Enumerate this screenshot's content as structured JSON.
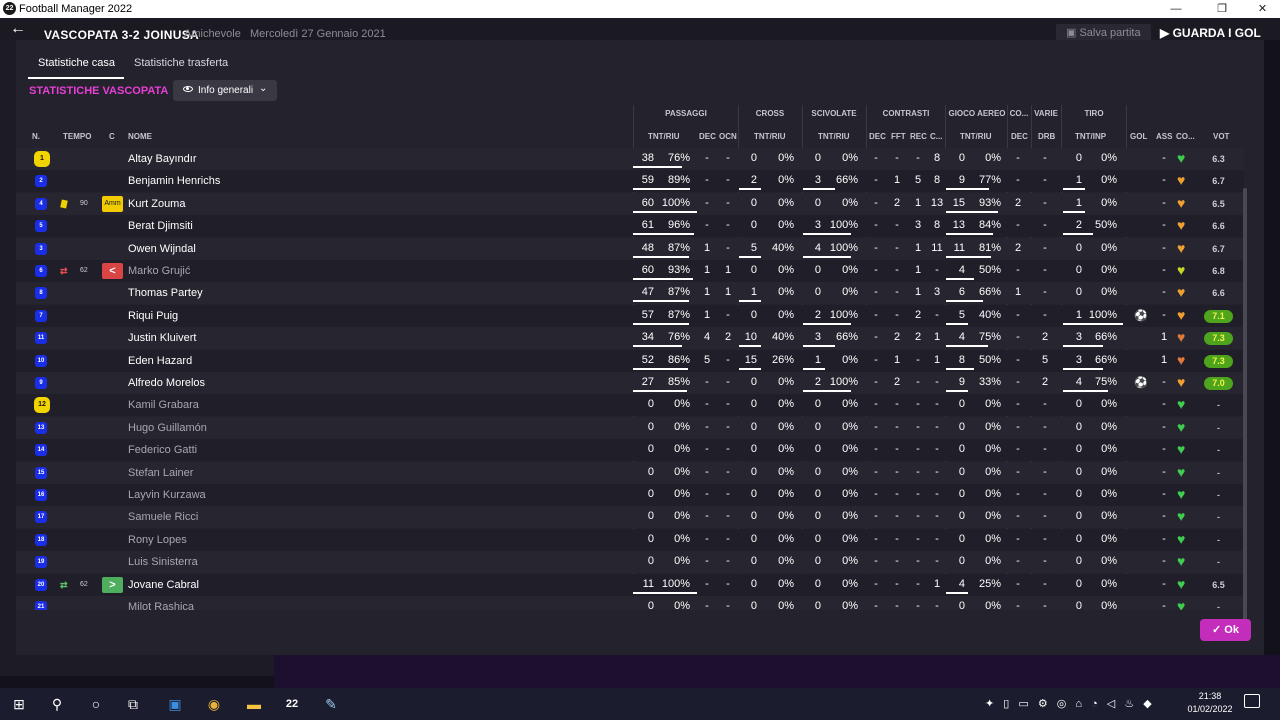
{
  "window": {
    "title": "Football Manager 2022",
    "min": "—",
    "max": "❐",
    "close": "✕"
  },
  "header": {
    "score": "VASCOPATA 3-2 JOINUSA",
    "match_type": "Amichevole",
    "date": "Mercoledì 27 Gennaio 2021",
    "save_label": "Salva partita",
    "continue_label": "GUARDA I GOL"
  },
  "tabs": {
    "home": "Statistiche casa",
    "away": "Statistiche trasferta"
  },
  "section": {
    "title": "STATISTICHE VASCOPATA",
    "view": "Info generali"
  },
  "groups": {
    "passaggi": "PASSAGGI",
    "cross": "CROSS",
    "scivolate": "SCIVOLATE",
    "contrasti": "CONTRASTI",
    "gioco_aereo": "GIOCO AEREO",
    "co": "CO...",
    "varie": "VARIE",
    "tiro": "TIRO"
  },
  "columns": {
    "n": "N.",
    "tempo": "TEMPO",
    "c": "C",
    "nome": "NOME",
    "pass_tnt": "TNT/RIU",
    "pass_dec": "DEC",
    "pass_ocn": "OCN",
    "cross_tnt": "TNT/RIU",
    "sciv_tnt": "TNT/RIU",
    "con_dec": "DEC",
    "con_fft": "FFT",
    "con_rec": "REC",
    "con_c": "C...",
    "aereo_tnt": "TNT/RIU",
    "co_dec": "DEC",
    "varie_drb": "DRB",
    "tiro_tnt": "TNT/INP",
    "gol": "GOL",
    "ass": "ASS",
    "co2": "CO...",
    "vot": "VOT"
  },
  "players": [
    {
      "num": "1",
      "gk": true,
      "tempo": "",
      "event": "",
      "cbox": "",
      "name": "Altay Bayındır",
      "dim": false,
      "pt": "38",
      "pp": "76%",
      "pdec": "-",
      "pocn": "-",
      "ct": "0",
      "cp": "0%",
      "st": "0",
      "sp": "0%",
      "cdec": "-",
      "cfft": "-",
      "crec": "-",
      "cc": "8",
      "at": "0",
      "ap": "0%",
      "codec": "-",
      "drb": "-",
      "tt": "0",
      "tp": "0%",
      "gol": "",
      "ass": "-",
      "heart": "#3fcc4f",
      "vote": "6.3",
      "vhi": false
    },
    {
      "num": "2",
      "gk": false,
      "tempo": "",
      "event": "",
      "cbox": "",
      "name": "Benjamin Henrichs",
      "dim": false,
      "pt": "59",
      "pp": "89%",
      "pdec": "-",
      "pocn": "-",
      "ct": "2",
      "cp": "0%",
      "st": "3",
      "sp": "66%",
      "cdec": "-",
      "cfft": "1",
      "crec": "5",
      "cc": "8",
      "at": "9",
      "ap": "77%",
      "codec": "-",
      "drb": "-",
      "tt": "1",
      "tp": "0%",
      "gol": "",
      "ass": "-",
      "heart": "#f0a030",
      "vote": "6.7",
      "vhi": false
    },
    {
      "num": "4",
      "gk": false,
      "tempo": "90",
      "event": "yellow",
      "cbox": "amm",
      "cbox_label": "Amm",
      "name": "Kurt Zouma",
      "dim": false,
      "pt": "60",
      "pp": "100%",
      "pdec": "-",
      "pocn": "-",
      "ct": "0",
      "cp": "0%",
      "st": "0",
      "sp": "0%",
      "cdec": "-",
      "cfft": "2",
      "crec": "1",
      "cc": "13",
      "at": "15",
      "ap": "93%",
      "codec": "2",
      "drb": "-",
      "tt": "1",
      "tp": "0%",
      "gol": "",
      "ass": "-",
      "heart": "#f0a030",
      "vote": "6.5",
      "vhi": false
    },
    {
      "num": "5",
      "gk": false,
      "tempo": "",
      "event": "",
      "cbox": "",
      "name": "Berat Djimsiti",
      "dim": false,
      "pt": "61",
      "pp": "96%",
      "pdec": "-",
      "pocn": "-",
      "ct": "0",
      "cp": "0%",
      "st": "3",
      "sp": "100%",
      "cdec": "-",
      "cfft": "-",
      "crec": "3",
      "cc": "8",
      "at": "13",
      "ap": "84%",
      "codec": "-",
      "drb": "-",
      "tt": "2",
      "tp": "50%",
      "gol": "",
      "ass": "-",
      "heart": "#f0a030",
      "vote": "6.6",
      "vhi": false
    },
    {
      "num": "3",
      "gk": false,
      "tempo": "",
      "event": "",
      "cbox": "",
      "name": "Owen Wijndal",
      "dim": false,
      "pt": "48",
      "pp": "87%",
      "pdec": "1",
      "pocn": "-",
      "ct": "5",
      "cp": "40%",
      "st": "4",
      "sp": "100%",
      "cdec": "-",
      "cfft": "-",
      "crec": "1",
      "cc": "11",
      "at": "11",
      "ap": "81%",
      "codec": "2",
      "drb": "-",
      "tt": "0",
      "tp": "0%",
      "gol": "",
      "ass": "-",
      "heart": "#f0a030",
      "vote": "6.7",
      "vhi": false
    },
    {
      "num": "6",
      "gk": false,
      "tempo": "62",
      "event": "out",
      "cbox": "subout",
      "cbox_label": "<",
      "name": "Marko Grujić",
      "dim": true,
      "pt": "60",
      "pp": "93%",
      "pdec": "1",
      "pocn": "1",
      "ct": "0",
      "cp": "0%",
      "st": "0",
      "sp": "0%",
      "cdec": "-",
      "cfft": "-",
      "crec": "1",
      "cc": "-",
      "at": "4",
      "ap": "50%",
      "codec": "-",
      "drb": "-",
      "tt": "0",
      "tp": "0%",
      "gol": "",
      "ass": "-",
      "heart": "#c8d628",
      "vote": "6.8",
      "vhi": false
    },
    {
      "num": "8",
      "gk": false,
      "tempo": "",
      "event": "",
      "cbox": "",
      "name": "Thomas Partey",
      "dim": false,
      "pt": "47",
      "pp": "87%",
      "pdec": "1",
      "pocn": "1",
      "ct": "1",
      "cp": "0%",
      "st": "0",
      "sp": "0%",
      "cdec": "-",
      "cfft": "-",
      "crec": "1",
      "cc": "3",
      "at": "6",
      "ap": "66%",
      "codec": "1",
      "drb": "-",
      "tt": "0",
      "tp": "0%",
      "gol": "",
      "ass": "-",
      "heart": "#f0a030",
      "vote": "6.6",
      "vhi": false
    },
    {
      "num": "7",
      "gk": false,
      "tempo": "",
      "event": "",
      "cbox": "",
      "name": "Riqui Puig",
      "dim": false,
      "pt": "57",
      "pp": "87%",
      "pdec": "1",
      "pocn": "-",
      "ct": "0",
      "cp": "0%",
      "st": "2",
      "sp": "100%",
      "cdec": "-",
      "cfft": "-",
      "crec": "2",
      "cc": "-",
      "at": "5",
      "ap": "40%",
      "codec": "-",
      "drb": "-",
      "tt": "1",
      "tp": "100%",
      "gol": "⚽",
      "ass": "-",
      "heart": "#f0a030",
      "vote": "7.1",
      "vhi": true
    },
    {
      "num": "11",
      "gk": false,
      "tempo": "",
      "event": "",
      "cbox": "",
      "name": "Justin Kluivert",
      "dim": false,
      "pt": "34",
      "pp": "76%",
      "pdec": "4",
      "pocn": "2",
      "ct": "10",
      "cp": "40%",
      "st": "3",
      "sp": "66%",
      "cdec": "-",
      "cfft": "2",
      "crec": "2",
      "cc": "1",
      "at": "4",
      "ap": "75%",
      "codec": "-",
      "drb": "2",
      "tt": "3",
      "tp": "66%",
      "gol": "",
      "ass": "1",
      "heart": "#e07a3a",
      "vote": "7.3",
      "vhi": true
    },
    {
      "num": "10",
      "gk": false,
      "tempo": "",
      "event": "",
      "cbox": "",
      "name": "Eden Hazard",
      "dim": false,
      "pt": "52",
      "pp": "86%",
      "pdec": "5",
      "pocn": "-",
      "ct": "15",
      "cp": "26%",
      "st": "1",
      "sp": "0%",
      "cdec": "-",
      "cfft": "1",
      "crec": "-",
      "cc": "1",
      "at": "8",
      "ap": "50%",
      "codec": "-",
      "drb": "5",
      "tt": "3",
      "tp": "66%",
      "gol": "",
      "ass": "1",
      "heart": "#e07a3a",
      "vote": "7.3",
      "vhi": true
    },
    {
      "num": "9",
      "gk": false,
      "tempo": "",
      "event": "",
      "cbox": "",
      "name": "Alfredo Morelos",
      "dim": false,
      "pt": "27",
      "pp": "85%",
      "pdec": "-",
      "pocn": "-",
      "ct": "0",
      "cp": "0%",
      "st": "2",
      "sp": "100%",
      "cdec": "-",
      "cfft": "2",
      "crec": "-",
      "cc": "-",
      "at": "9",
      "ap": "33%",
      "codec": "-",
      "drb": "2",
      "tt": "4",
      "tp": "75%",
      "gol": "⚽",
      "ass": "-",
      "heart": "#f0a030",
      "vote": "7.0",
      "vhi": true
    },
    {
      "num": "12",
      "gk": true,
      "tempo": "",
      "event": "",
      "cbox": "",
      "name": "Kamil Grabara",
      "dim": true,
      "pt": "0",
      "pp": "0%",
      "pdec": "-",
      "pocn": "-",
      "ct": "0",
      "cp": "0%",
      "st": "0",
      "sp": "0%",
      "cdec": "-",
      "cfft": "-",
      "crec": "-",
      "cc": "-",
      "at": "0",
      "ap": "0%",
      "codec": "-",
      "drb": "-",
      "tt": "0",
      "tp": "0%",
      "gol": "",
      "ass": "-",
      "heart": "#3fcc4f",
      "vote": "-",
      "vhi": false
    },
    {
      "num": "13",
      "gk": false,
      "tempo": "",
      "event": "",
      "cbox": "",
      "name": "Hugo Guillamón",
      "dim": true,
      "pt": "0",
      "pp": "0%",
      "pdec": "-",
      "pocn": "-",
      "ct": "0",
      "cp": "0%",
      "st": "0",
      "sp": "0%",
      "cdec": "-",
      "cfft": "-",
      "crec": "-",
      "cc": "-",
      "at": "0",
      "ap": "0%",
      "codec": "-",
      "drb": "-",
      "tt": "0",
      "tp": "0%",
      "gol": "",
      "ass": "-",
      "heart": "#3fcc4f",
      "vote": "-",
      "vhi": false
    },
    {
      "num": "14",
      "gk": false,
      "tempo": "",
      "event": "",
      "cbox": "",
      "name": "Federico Gatti",
      "dim": true,
      "pt": "0",
      "pp": "0%",
      "pdec": "-",
      "pocn": "-",
      "ct": "0",
      "cp": "0%",
      "st": "0",
      "sp": "0%",
      "cdec": "-",
      "cfft": "-",
      "crec": "-",
      "cc": "-",
      "at": "0",
      "ap": "0%",
      "codec": "-",
      "drb": "-",
      "tt": "0",
      "tp": "0%",
      "gol": "",
      "ass": "-",
      "heart": "#3fcc4f",
      "vote": "-",
      "vhi": false
    },
    {
      "num": "15",
      "gk": false,
      "tempo": "",
      "event": "",
      "cbox": "",
      "name": "Stefan Lainer",
      "dim": true,
      "pt": "0",
      "pp": "0%",
      "pdec": "-",
      "pocn": "-",
      "ct": "0",
      "cp": "0%",
      "st": "0",
      "sp": "0%",
      "cdec": "-",
      "cfft": "-",
      "crec": "-",
      "cc": "-",
      "at": "0",
      "ap": "0%",
      "codec": "-",
      "drb": "-",
      "tt": "0",
      "tp": "0%",
      "gol": "",
      "ass": "-",
      "heart": "#3fcc4f",
      "vote": "-",
      "vhi": false
    },
    {
      "num": "16",
      "gk": false,
      "tempo": "",
      "event": "",
      "cbox": "",
      "name": "Layvin Kurzawa",
      "dim": true,
      "pt": "0",
      "pp": "0%",
      "pdec": "-",
      "pocn": "-",
      "ct": "0",
      "cp": "0%",
      "st": "0",
      "sp": "0%",
      "cdec": "-",
      "cfft": "-",
      "crec": "-",
      "cc": "-",
      "at": "0",
      "ap": "0%",
      "codec": "-",
      "drb": "-",
      "tt": "0",
      "tp": "0%",
      "gol": "",
      "ass": "-",
      "heart": "#3fcc4f",
      "vote": "-",
      "vhi": false
    },
    {
      "num": "17",
      "gk": false,
      "tempo": "",
      "event": "",
      "cbox": "",
      "name": "Samuele Ricci",
      "dim": true,
      "pt": "0",
      "pp": "0%",
      "pdec": "-",
      "pocn": "-",
      "ct": "0",
      "cp": "0%",
      "st": "0",
      "sp": "0%",
      "cdec": "-",
      "cfft": "-",
      "crec": "-",
      "cc": "-",
      "at": "0",
      "ap": "0%",
      "codec": "-",
      "drb": "-",
      "tt": "0",
      "tp": "0%",
      "gol": "",
      "ass": "-",
      "heart": "#3fcc4f",
      "vote": "-",
      "vhi": false
    },
    {
      "num": "18",
      "gk": false,
      "tempo": "",
      "event": "",
      "cbox": "",
      "name": "Rony Lopes",
      "dim": true,
      "pt": "0",
      "pp": "0%",
      "pdec": "-",
      "pocn": "-",
      "ct": "0",
      "cp": "0%",
      "st": "0",
      "sp": "0%",
      "cdec": "-",
      "cfft": "-",
      "crec": "-",
      "cc": "-",
      "at": "0",
      "ap": "0%",
      "codec": "-",
      "drb": "-",
      "tt": "0",
      "tp": "0%",
      "gol": "",
      "ass": "-",
      "heart": "#3fcc4f",
      "vote": "-",
      "vhi": false
    },
    {
      "num": "19",
      "gk": false,
      "tempo": "",
      "event": "",
      "cbox": "",
      "name": "Luis Sinisterra",
      "dim": true,
      "pt": "0",
      "pp": "0%",
      "pdec": "-",
      "pocn": "-",
      "ct": "0",
      "cp": "0%",
      "st": "0",
      "sp": "0%",
      "cdec": "-",
      "cfft": "-",
      "crec": "-",
      "cc": "-",
      "at": "0",
      "ap": "0%",
      "codec": "-",
      "drb": "-",
      "tt": "0",
      "tp": "0%",
      "gol": "",
      "ass": "-",
      "heart": "#3fcc4f",
      "vote": "-",
      "vhi": false
    },
    {
      "num": "20",
      "gk": false,
      "tempo": "62",
      "event": "in",
      "cbox": "subin",
      "cbox_label": ">",
      "name": "Jovane Cabral",
      "dim": false,
      "pt": "11",
      "pp": "100%",
      "pdec": "-",
      "pocn": "-",
      "ct": "0",
      "cp": "0%",
      "st": "0",
      "sp": "0%",
      "cdec": "-",
      "cfft": "-",
      "crec": "-",
      "cc": "1",
      "at": "4",
      "ap": "25%",
      "codec": "-",
      "drb": "-",
      "tt": "0",
      "tp": "0%",
      "gol": "",
      "ass": "-",
      "heart": "#3fcc4f",
      "vote": "6.5",
      "vhi": false
    },
    {
      "num": "21",
      "gk": false,
      "tempo": "",
      "event": "",
      "cbox": "",
      "name": "Milot Rashica",
      "dim": true,
      "pt": "0",
      "pp": "0%",
      "pdec": "-",
      "pocn": "-",
      "ct": "0",
      "cp": "0%",
      "st": "0",
      "sp": "0%",
      "cdec": "-",
      "cfft": "-",
      "crec": "-",
      "cc": "-",
      "at": "0",
      "ap": "0%",
      "codec": "-",
      "drb": "-",
      "tt": "0",
      "tp": "0%",
      "gol": "",
      "ass": "-",
      "heart": "#3fcc4f",
      "vote": "-",
      "vhi": false
    }
  ],
  "ok_label": "Ok",
  "taskbar": {
    "time": "21:38",
    "date": "01/02/2022"
  }
}
